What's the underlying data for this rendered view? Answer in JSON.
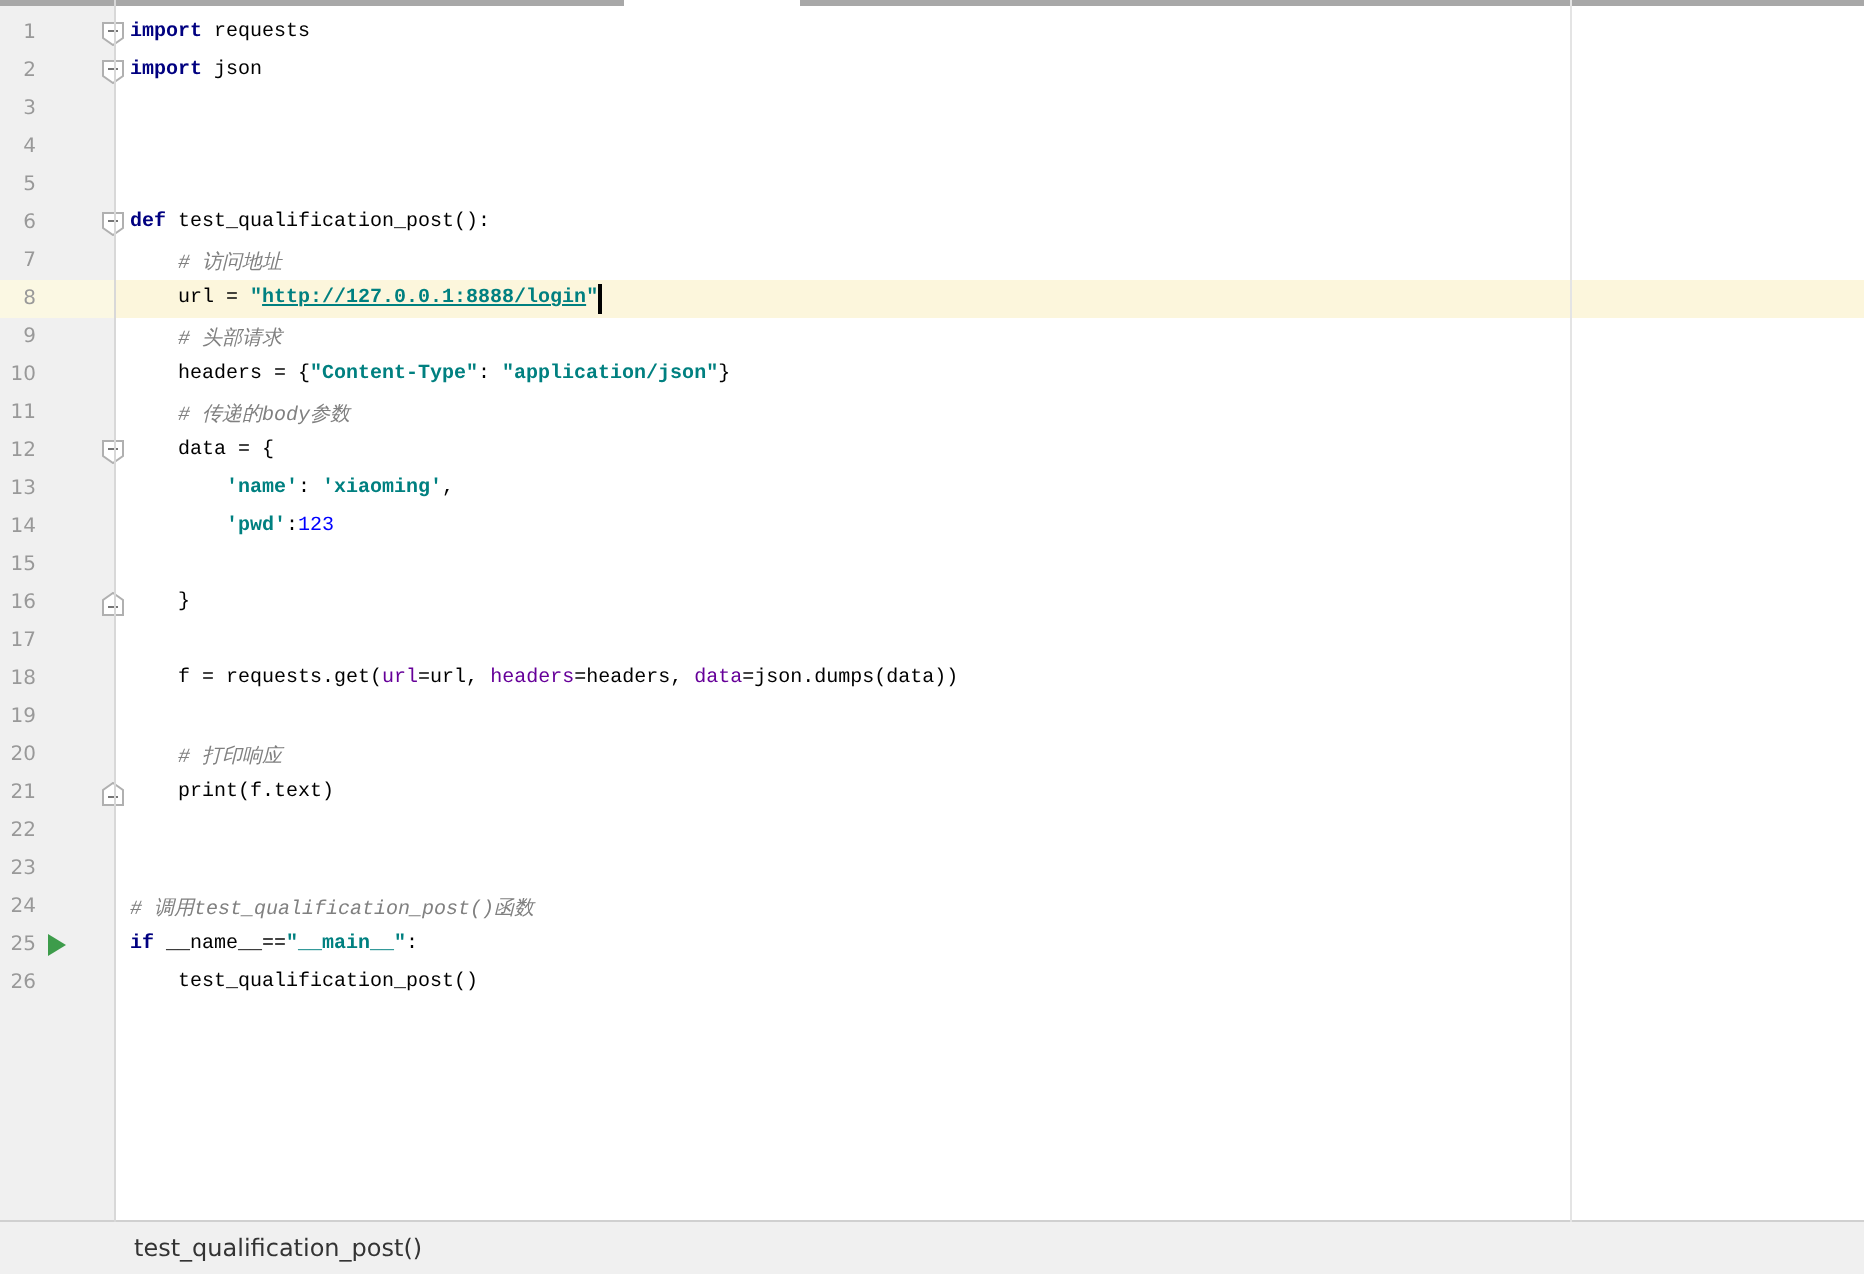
{
  "editor": {
    "lines": [
      {
        "number": "1",
        "fold_start": true,
        "tokens": [
          {
            "kind": "kw",
            "text": "import"
          },
          {
            "kind": "plain",
            "text": " requests"
          }
        ]
      },
      {
        "number": "2",
        "fold_start": true,
        "tokens": [
          {
            "kind": "kw",
            "text": "import"
          },
          {
            "kind": "plain",
            "text": " json"
          }
        ]
      },
      {
        "number": "3"
      },
      {
        "number": "4"
      },
      {
        "number": "5"
      },
      {
        "number": "6",
        "fold_start": true,
        "tokens": [
          {
            "kind": "kw",
            "text": "def"
          },
          {
            "kind": "plain",
            "text": " test_qualification_post():"
          }
        ]
      },
      {
        "number": "7",
        "tokens": [
          {
            "kind": "comment",
            "text": "    # 访问地址"
          }
        ]
      },
      {
        "number": "8",
        "current": true,
        "tokens": [
          {
            "kind": "plain",
            "text": "    url = "
          },
          {
            "kind": "str",
            "text": "\""
          },
          {
            "kind": "link",
            "text": "http://127.0.0.1:8888/login"
          },
          {
            "kind": "str",
            "text": "\""
          }
        ]
      },
      {
        "number": "9",
        "tokens": [
          {
            "kind": "comment",
            "text": "    # 头部请求"
          }
        ]
      },
      {
        "number": "10",
        "tokens": [
          {
            "kind": "plain",
            "text": "    headers = {"
          },
          {
            "kind": "str",
            "text": "\"Content-Type\""
          },
          {
            "kind": "plain",
            "text": ": "
          },
          {
            "kind": "str",
            "text": "\"application/json\""
          },
          {
            "kind": "plain",
            "text": "}"
          }
        ]
      },
      {
        "number": "11",
        "tokens": [
          {
            "kind": "comment",
            "text": "    # 传递的body参数"
          }
        ]
      },
      {
        "number": "12",
        "fold_start": true,
        "tokens": [
          {
            "kind": "plain",
            "text": "    data = {"
          }
        ]
      },
      {
        "number": "13",
        "tokens": [
          {
            "kind": "str",
            "text": "        'name'"
          },
          {
            "kind": "plain",
            "text": ": "
          },
          {
            "kind": "str",
            "text": "'xiaoming'"
          },
          {
            "kind": "plain",
            "text": ","
          }
        ]
      },
      {
        "number": "14",
        "tokens": [
          {
            "kind": "str",
            "text": "        'pwd'"
          },
          {
            "kind": "plain",
            "text": ":"
          },
          {
            "kind": "num",
            "text": "123"
          }
        ]
      },
      {
        "number": "15"
      },
      {
        "number": "16",
        "fold_end": true,
        "tokens": [
          {
            "kind": "plain",
            "text": "    }"
          }
        ]
      },
      {
        "number": "17"
      },
      {
        "number": "18",
        "tokens": [
          {
            "kind": "plain",
            "text": "    f = requests.get("
          },
          {
            "kind": "param",
            "text": "url"
          },
          {
            "kind": "plain",
            "text": "=url, "
          },
          {
            "kind": "param",
            "text": "headers"
          },
          {
            "kind": "plain",
            "text": "=headers, "
          },
          {
            "kind": "param",
            "text": "data"
          },
          {
            "kind": "plain",
            "text": "=json.dumps(data))"
          }
        ]
      },
      {
        "number": "19"
      },
      {
        "number": "20",
        "tokens": [
          {
            "kind": "comment",
            "text": "    # 打印响应"
          }
        ]
      },
      {
        "number": "21",
        "fold_end": true,
        "tokens": [
          {
            "kind": "plain",
            "text": "    print(f.text)"
          }
        ]
      },
      {
        "number": "22"
      },
      {
        "number": "23"
      },
      {
        "number": "24",
        "tokens": [
          {
            "kind": "comment",
            "text": "# 调用test_qualification_post()函数"
          }
        ]
      },
      {
        "number": "25",
        "run": true,
        "tokens": [
          {
            "kind": "kw",
            "text": "if"
          },
          {
            "kind": "plain",
            "text": " __name__=="
          },
          {
            "kind": "str",
            "text": "\"__main__\""
          },
          {
            "kind": "plain",
            "text": ":"
          }
        ]
      },
      {
        "number": "26",
        "tokens": [
          {
            "kind": "plain",
            "text": "    test_qualification_post()"
          }
        ]
      }
    ]
  },
  "status_bar": {
    "breadcrumb": "test_qualification_post()"
  }
}
